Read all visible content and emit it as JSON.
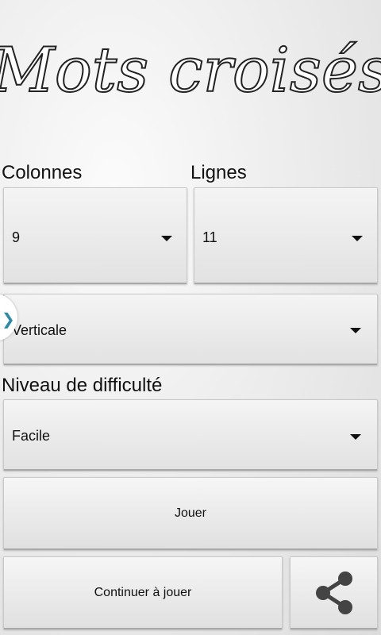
{
  "app": {
    "title": "Mots croisés"
  },
  "columns": {
    "label": "Colonnes",
    "value": "9"
  },
  "rows": {
    "label": "Lignes",
    "value": "11"
  },
  "orientation": {
    "value": "Verticale"
  },
  "difficulty": {
    "label": "Niveau de difficulté",
    "value": "Facile"
  },
  "buttons": {
    "play": "Jouer",
    "continue": "Continuer à jouer"
  },
  "icons": {
    "share": "share-icon",
    "side_tab": "chevron-right-icon",
    "dropdown": "dropdown-arrow-icon"
  },
  "colors": {
    "side_tab_chevron": "#2a8aa8"
  }
}
